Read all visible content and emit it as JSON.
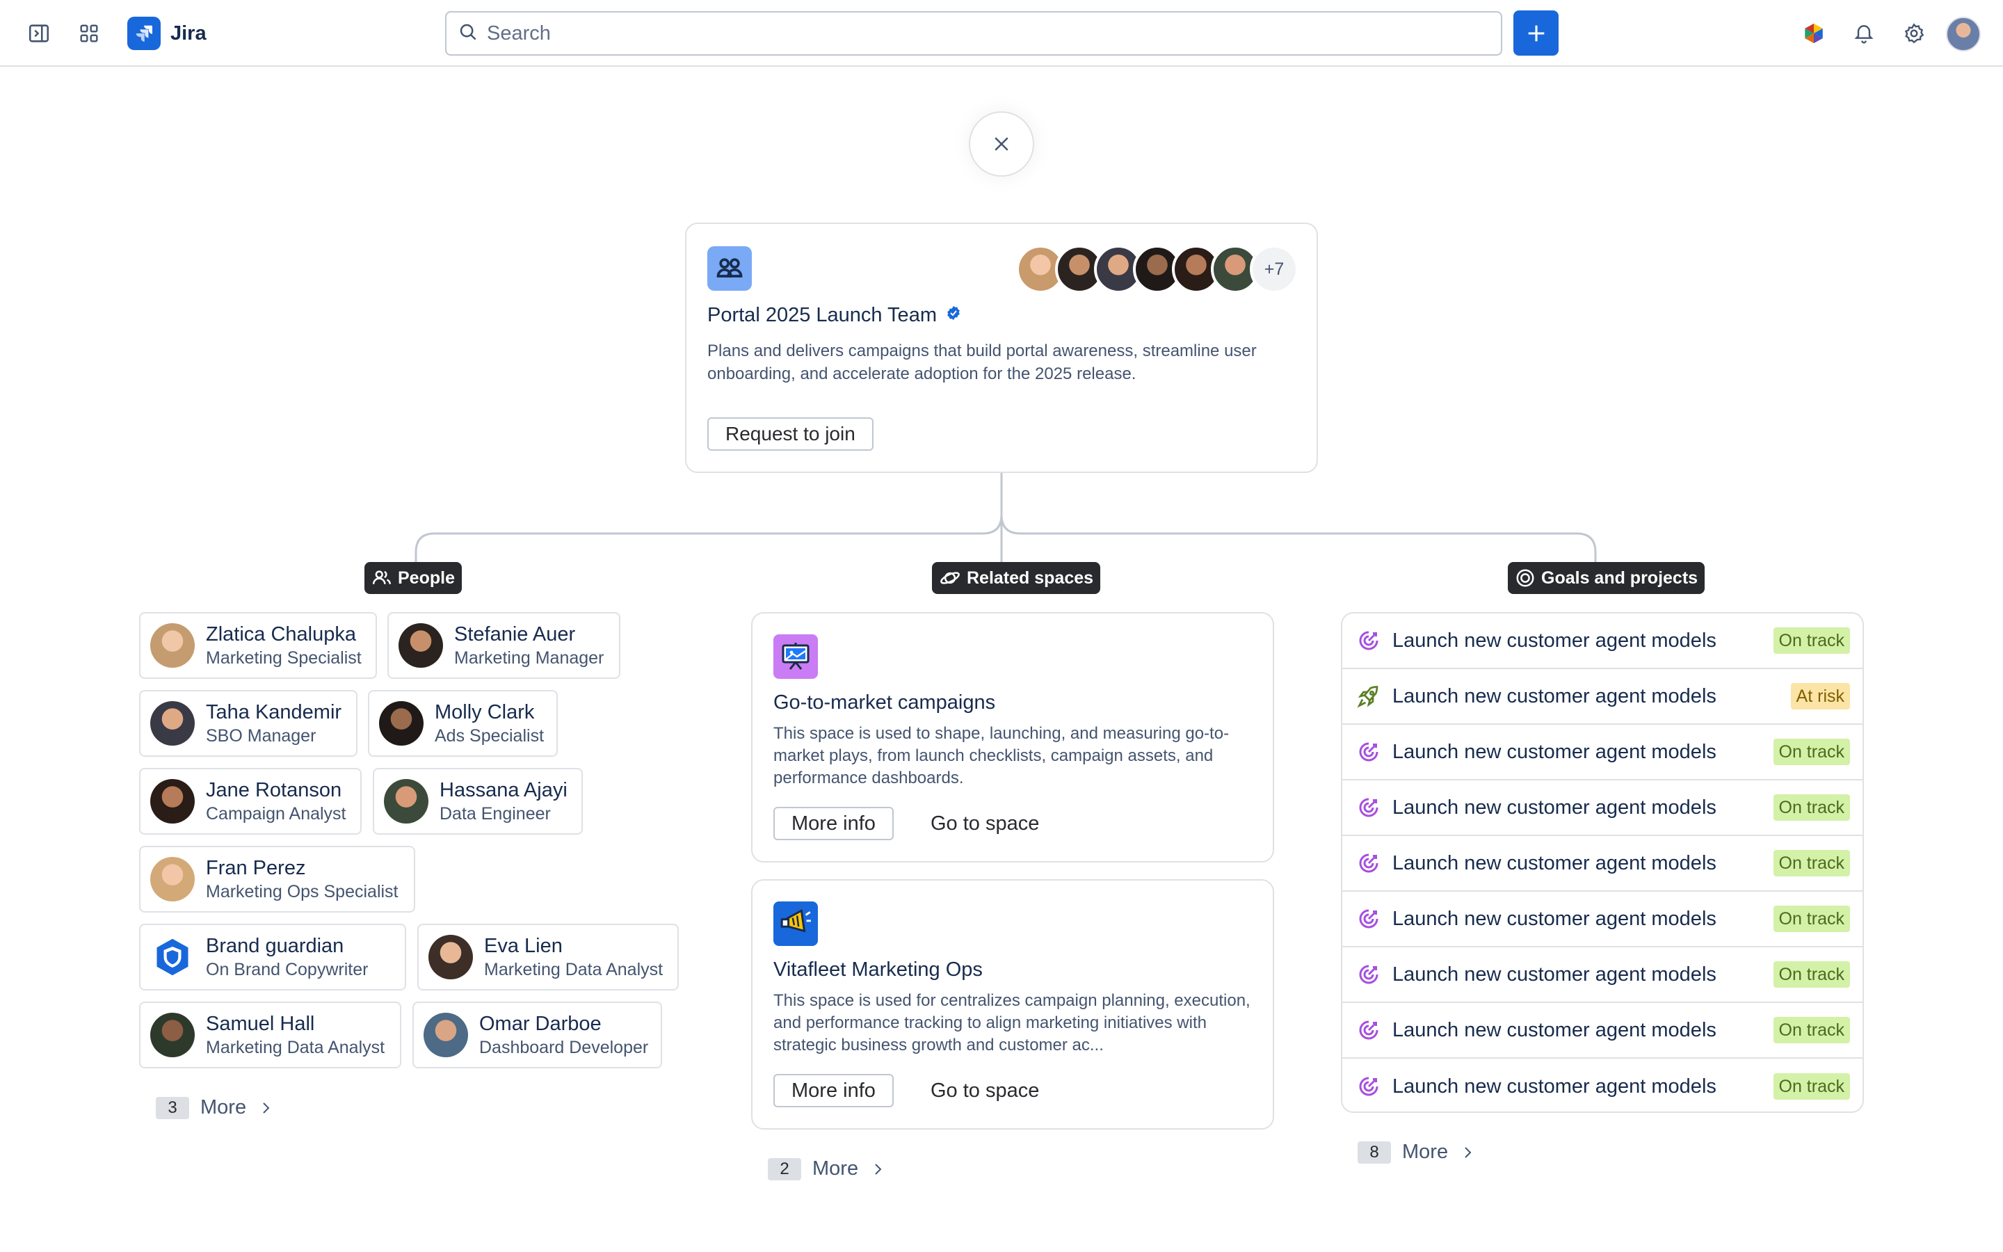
{
  "app": {
    "name": "Jira"
  },
  "search": {
    "placeholder": "Search"
  },
  "team": {
    "title": "Portal 2025 Launch Team",
    "description": "Plans and delivers campaigns that build portal awareness, streamline user onboarding, and accelerate adoption for the 2025 release.",
    "join_label": "Request to join",
    "more_members": "+7"
  },
  "sections": {
    "people": "People",
    "spaces": "Related spaces",
    "goals": "Goals and projects"
  },
  "people": [
    {
      "name": "Zlatica Chalupka",
      "role": "Marketing Specialist"
    },
    {
      "name": "Stefanie Auer",
      "role": "Marketing Manager"
    },
    {
      "name": "Taha Kandemir",
      "role": "SBO Manager"
    },
    {
      "name": "Molly Clark",
      "role": "Ads Specialist"
    },
    {
      "name": "Jane Rotanson",
      "role": "Campaign Analyst"
    },
    {
      "name": "Hassana Ajayi",
      "role": "Data Engineer"
    },
    {
      "name": "Fran Perez",
      "role": "Marketing Ops Specialist"
    },
    {
      "name": "Brand guardian",
      "role": "On Brand Copywriter"
    },
    {
      "name": "Eva Lien",
      "role": "Marketing Data Analyst"
    },
    {
      "name": "Samuel Hall",
      "role": "Marketing Data Analyst"
    },
    {
      "name": "Omar Darboe",
      "role": "Dashboard Developer"
    }
  ],
  "people_more": {
    "count": "3",
    "label": "More"
  },
  "spaces": [
    {
      "title": "Go-to-market campaigns",
      "description": "This space is used to shape, launching, and measuring go-to-market plays, from launch checklists, campaign assets, and performance dashboards.",
      "more_info": "More info",
      "go": "Go to space"
    },
    {
      "title": "Vitafleet Marketing Ops",
      "description": "This space is used for centralizes campaign planning, execution, and performance tracking to align marketing initiatives with strategic business growth and customer ac...",
      "more_info": "More info",
      "go": "Go to space"
    }
  ],
  "spaces_more": {
    "count": "2",
    "label": "More"
  },
  "goals": [
    {
      "title": "Launch new customer agent models",
      "status": "On track"
    },
    {
      "title": "Launch new customer agent models",
      "status": "At risk"
    },
    {
      "title": "Launch new customer agent models",
      "status": "On track"
    },
    {
      "title": "Launch new customer agent models",
      "status": "On track"
    },
    {
      "title": "Launch new customer agent models",
      "status": "On track"
    },
    {
      "title": "Launch new customer agent models",
      "status": "On track"
    },
    {
      "title": "Launch new customer agent models",
      "status": "On track"
    },
    {
      "title": "Launch new customer agent models",
      "status": "On track"
    },
    {
      "title": "Launch new customer agent models",
      "status": "On track"
    }
  ],
  "goals_more": {
    "count": "8",
    "label": "More"
  },
  "colors": {
    "brand": "#1868db",
    "on_track_bg": "#d3f1a7",
    "at_risk_bg": "#fce4a6",
    "section_label_bg": "#292a2e",
    "goal_icon": "#a64fde",
    "project_icon": "#5b7f24"
  }
}
